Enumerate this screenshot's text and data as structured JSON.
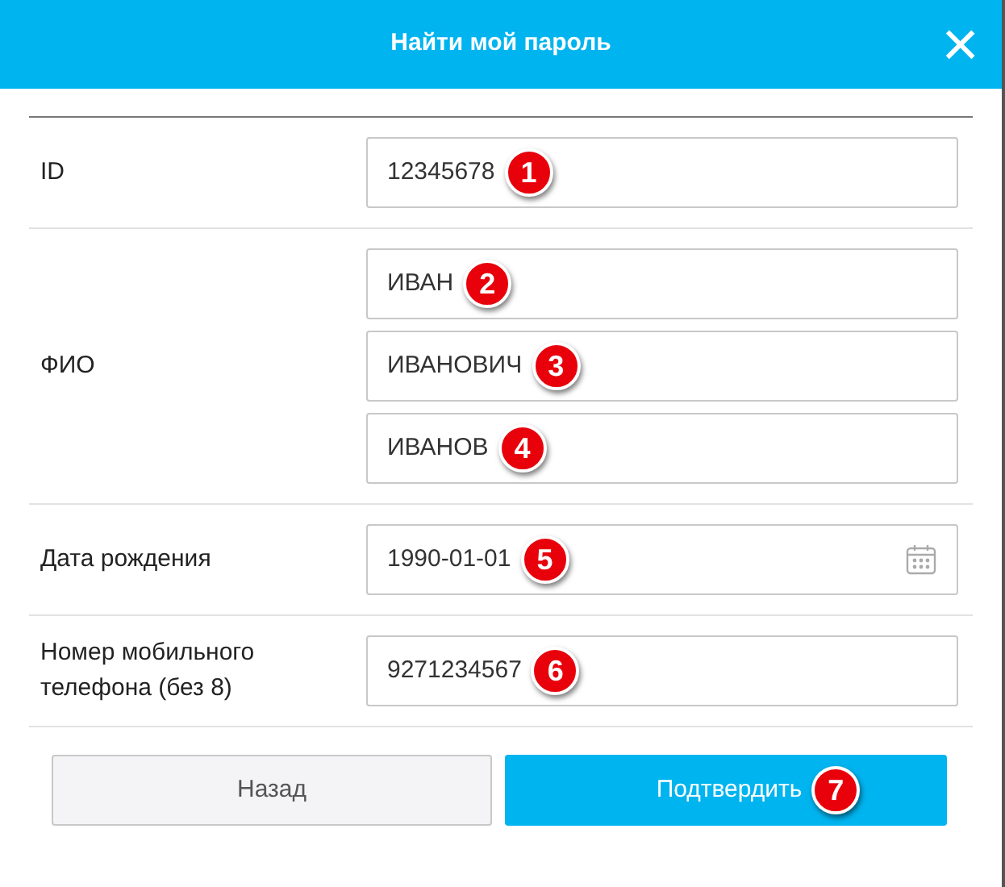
{
  "dialog": {
    "title": "Найти мой пароль",
    "close": "×"
  },
  "rows": [
    {
      "label": "ID",
      "fields": [
        {
          "kind": "text",
          "value": "12345678",
          "badge": "1"
        }
      ]
    },
    {
      "label": "ФИО",
      "fields": [
        {
          "kind": "text",
          "value": "ИВАН",
          "badge": "2"
        },
        {
          "kind": "text",
          "value": "ИВАНОВИЧ",
          "badge": "3"
        },
        {
          "kind": "text",
          "value": "ИВАНОВ",
          "badge": "4"
        }
      ]
    },
    {
      "label": "Дата рождения",
      "fields": [
        {
          "kind": "date",
          "value": "1990-01-01",
          "badge": "5"
        }
      ]
    },
    {
      "label": "Номер мобильного телефона (без 8)",
      "fields": [
        {
          "kind": "text",
          "value": "9271234567",
          "badge": "6"
        }
      ]
    }
  ],
  "buttons": [
    {
      "kind": "secondary",
      "label": "Назад"
    },
    {
      "kind": "primary",
      "label": "Подтвердить",
      "badge": "7"
    }
  ]
}
